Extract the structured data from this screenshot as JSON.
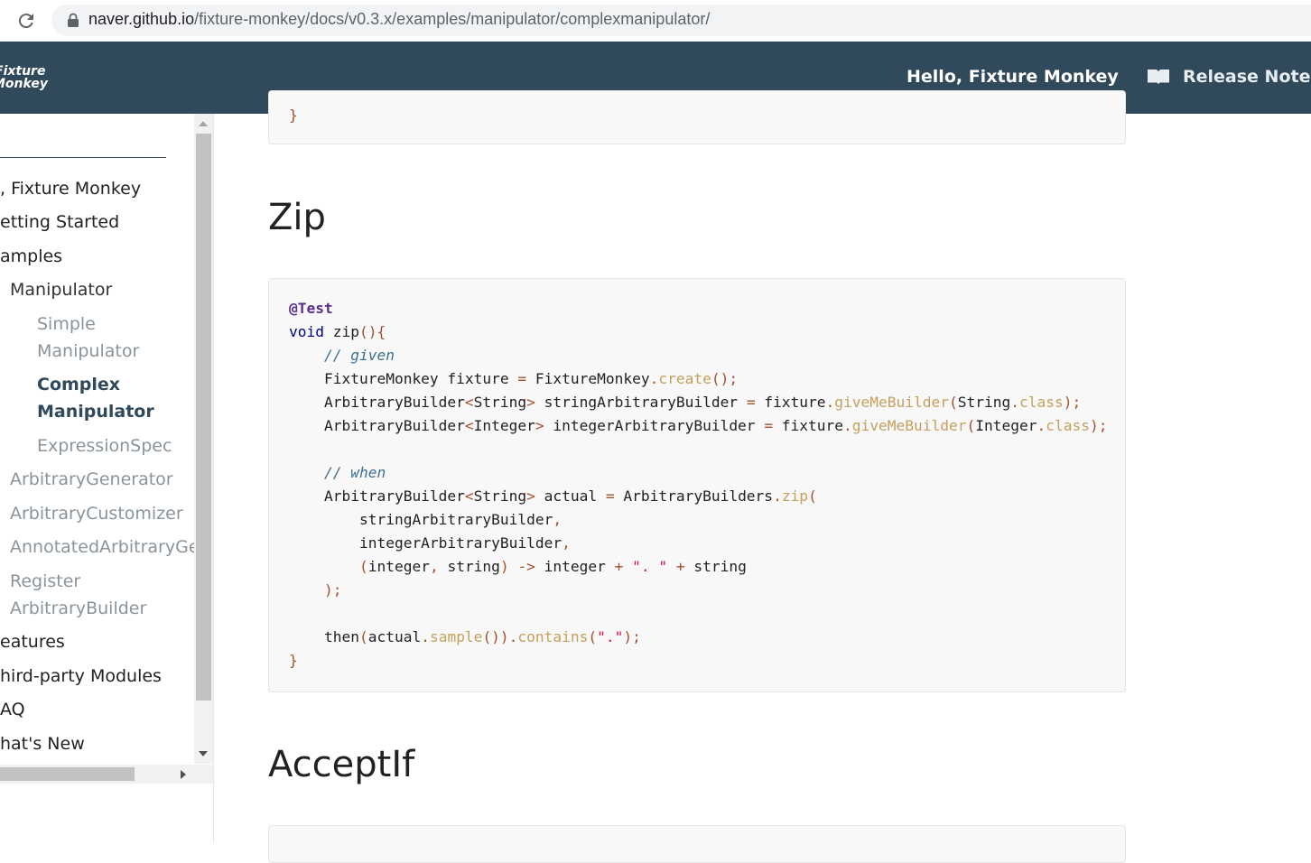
{
  "browser": {
    "url_host": "naver.github.io",
    "url_path": "/fixture-monkey/docs/v0.3.x/examples/manipulator/complexmanipulator/"
  },
  "header": {
    "logo_line1": "Fixture",
    "logo_line2": "Monkey",
    "nav_hello": "Hello, Fixture Monkey",
    "nav_release": "Release Notes",
    "bg_color": "#30495b"
  },
  "sidebar": {
    "items": [
      {
        "label": ", Fixture Monkey",
        "level": 1
      },
      {
        "label": "etting Started",
        "level": 1
      },
      {
        "label": "amples",
        "level": 1
      },
      {
        "label": "Manipulator",
        "level": 2
      },
      {
        "label": "Simple",
        "level": 3
      },
      {
        "label": "Manipulator",
        "level": 3
      },
      {
        "label": "Complex",
        "level": 3,
        "active": true
      },
      {
        "label": "Manipulator",
        "level": 3,
        "active": true
      },
      {
        "label": "ExpressionSpec",
        "level": 3
      },
      {
        "label": "ArbitraryGenerator",
        "level": 2
      },
      {
        "label": "ArbitraryCustomizer",
        "level": 2
      },
      {
        "label": "AnnotatedArbitraryGen",
        "level": 2
      },
      {
        "label": "Register",
        "level": 2
      },
      {
        "label": "ArbitraryBuilder",
        "level": 2
      },
      {
        "label": "eatures",
        "level": 1
      },
      {
        "label": "hird-party Modules",
        "level": 1
      },
      {
        "label": "AQ",
        "level": 1
      },
      {
        "label": "hat's New",
        "level": 1
      }
    ]
  },
  "content": {
    "prev_code_tail": "}",
    "zip_heading": "Zip",
    "zip_code": [
      "@Test",
      "void zip(){",
      "    // given",
      "    FixtureMonkey fixture = FixtureMonkey.create();",
      "    ArbitraryBuilder<String> stringArbitraryBuilder = fixture.giveMeBuilder(String.class);",
      "    ArbitraryBuilder<Integer> integerArbitraryBuilder = fixture.giveMeBuilder(Integer.class);",
      "",
      "    // when",
      "    ArbitraryBuilder<String> actual = ArbitraryBuilders.zip(",
      "        stringArbitraryBuilder,",
      "        integerArbitraryBuilder,",
      "        (integer, string) -> integer + \". \" + string",
      "    );",
      "",
      "    then(actual.sample()).contains(\".\");",
      "}"
    ],
    "acceptif_heading": "AcceptIf"
  }
}
